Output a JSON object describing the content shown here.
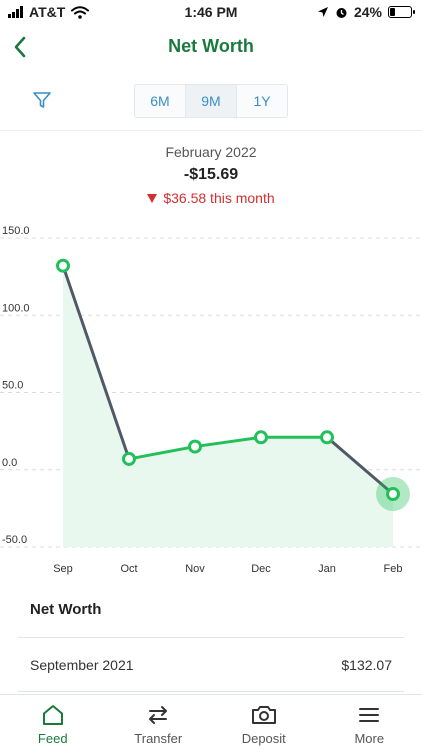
{
  "status_bar": {
    "carrier": "AT&T",
    "time": "1:46 PM",
    "battery": "24%",
    "battery_level": 0.24
  },
  "header": {
    "title": "Net Worth",
    "back_icon": "chevron-left-icon"
  },
  "range_selector": {
    "filter_icon": "filter-icon",
    "options": [
      "6M",
      "9M",
      "1Y"
    ],
    "selected": "9M"
  },
  "summary": {
    "date": "February 2022",
    "value": "-$15.69",
    "change": "$36.58 this month",
    "change_direction": "down"
  },
  "colors": {
    "brand_green": "#1a7a3d",
    "line_green": "#22c05a",
    "line_gray": "#4f5a66",
    "area_fill": "#e9f8ee",
    "negative_red": "#d32f2f",
    "accent_blue": "#3a8fc4"
  },
  "chart_data": {
    "type": "line",
    "categories": [
      "Sep",
      "Oct",
      "Nov",
      "Dec",
      "Jan",
      "Feb"
    ],
    "values": [
      132.07,
      7,
      15,
      21,
      21,
      -15.69
    ],
    "yticks": [
      "150.0",
      "100.0",
      "50.0",
      "0.0",
      "-50.0"
    ],
    "ylim": [
      -50,
      150
    ],
    "grid": "horizontal-dashed",
    "highlighted_point": "Feb"
  },
  "list": {
    "header": "Net Worth",
    "rows": [
      {
        "label": "September 2021",
        "value": "$132.07"
      }
    ]
  },
  "tab_bar": {
    "tabs": [
      {
        "label": "Feed",
        "icon": "home-icon",
        "active": true
      },
      {
        "label": "Transfer",
        "icon": "transfer-icon",
        "active": false
      },
      {
        "label": "Deposit",
        "icon": "camera-icon",
        "active": false
      },
      {
        "label": "More",
        "icon": "menu-icon",
        "active": false
      }
    ]
  }
}
